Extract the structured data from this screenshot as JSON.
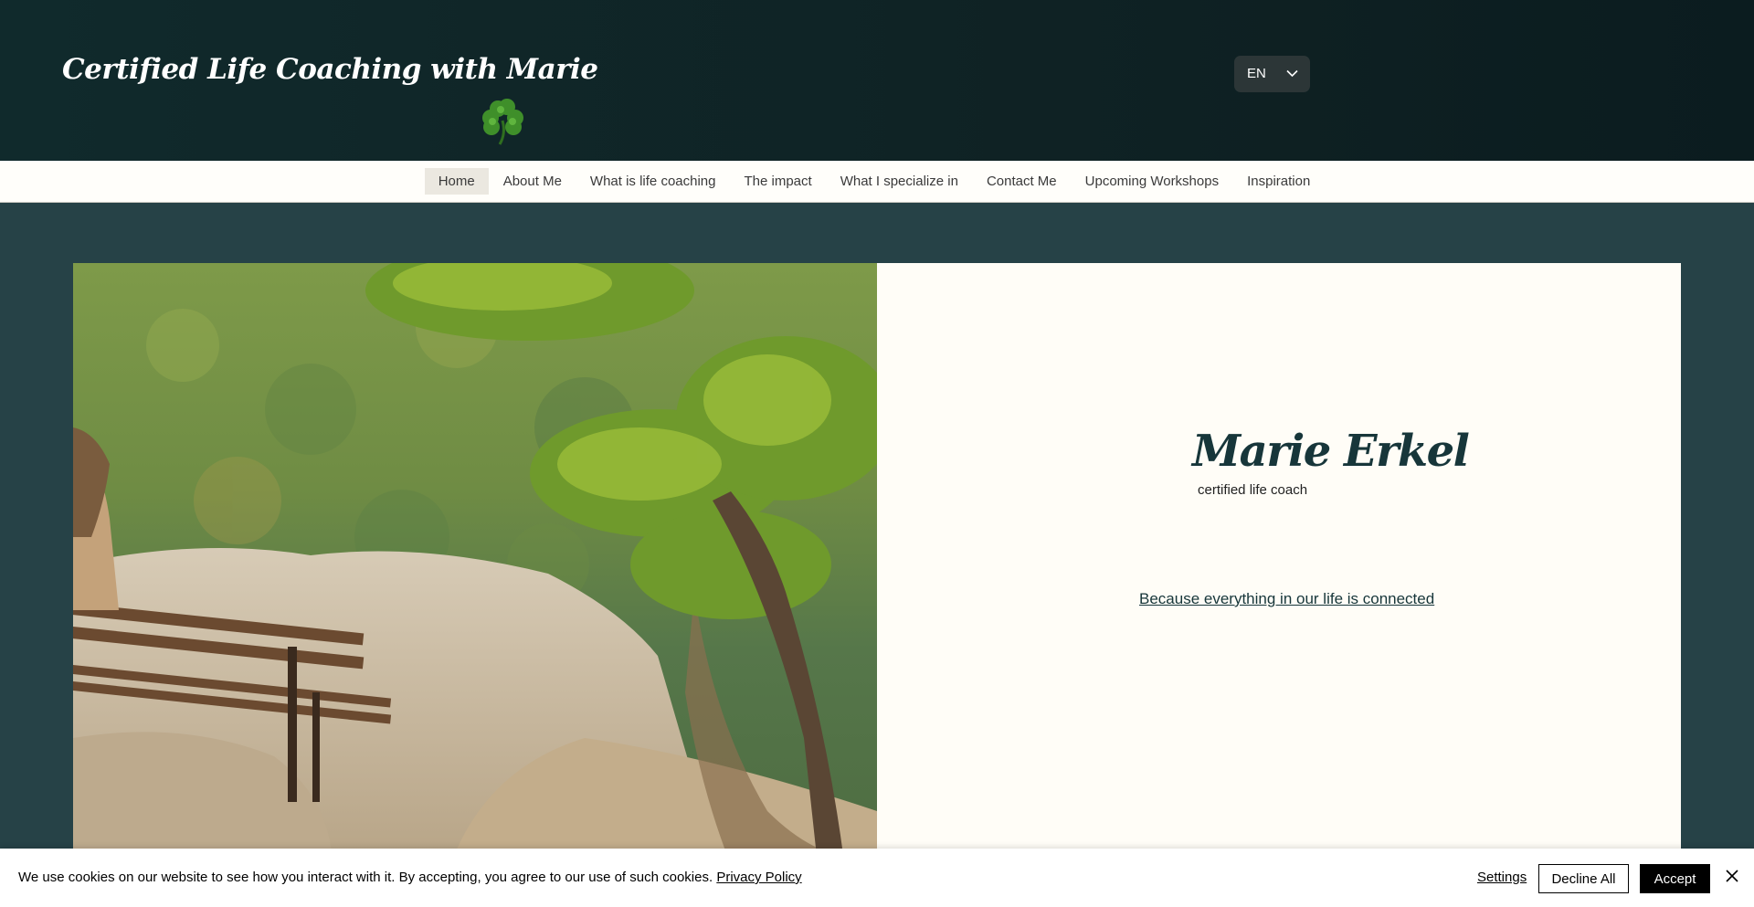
{
  "header": {
    "site_title": "Certified Life Coaching with Marie",
    "language": "EN"
  },
  "nav": {
    "items": [
      {
        "label": "Home",
        "active": true
      },
      {
        "label": "About Me"
      },
      {
        "label": "What is life coaching"
      },
      {
        "label": "The impact"
      },
      {
        "label": "What I specialize in"
      },
      {
        "label": "Contact Me"
      },
      {
        "label": "Upcoming Workshops"
      },
      {
        "label": "Inspiration"
      }
    ]
  },
  "hero": {
    "name": "Marie Erkel",
    "subtitle": "certified life coach",
    "tagline": "Because everything in our life is connected"
  },
  "cookie_banner": {
    "message": "We use cookies on our website to see how you interact with it. By accepting, you agree to our use of such cookies.",
    "policy_link": "Privacy Policy",
    "settings": "Settings",
    "decline": "Decline All",
    "accept": "Accept"
  },
  "icons": {
    "logo": "shamrock-icon",
    "language": "chevron-down-icon",
    "close": "close-icon"
  },
  "colors": {
    "header_bg": "#0f2224",
    "page_bg": "#264247",
    "nav_bg": "#fffefa",
    "panel_bg": "#fffdf7",
    "accent_text": "#17363a"
  }
}
